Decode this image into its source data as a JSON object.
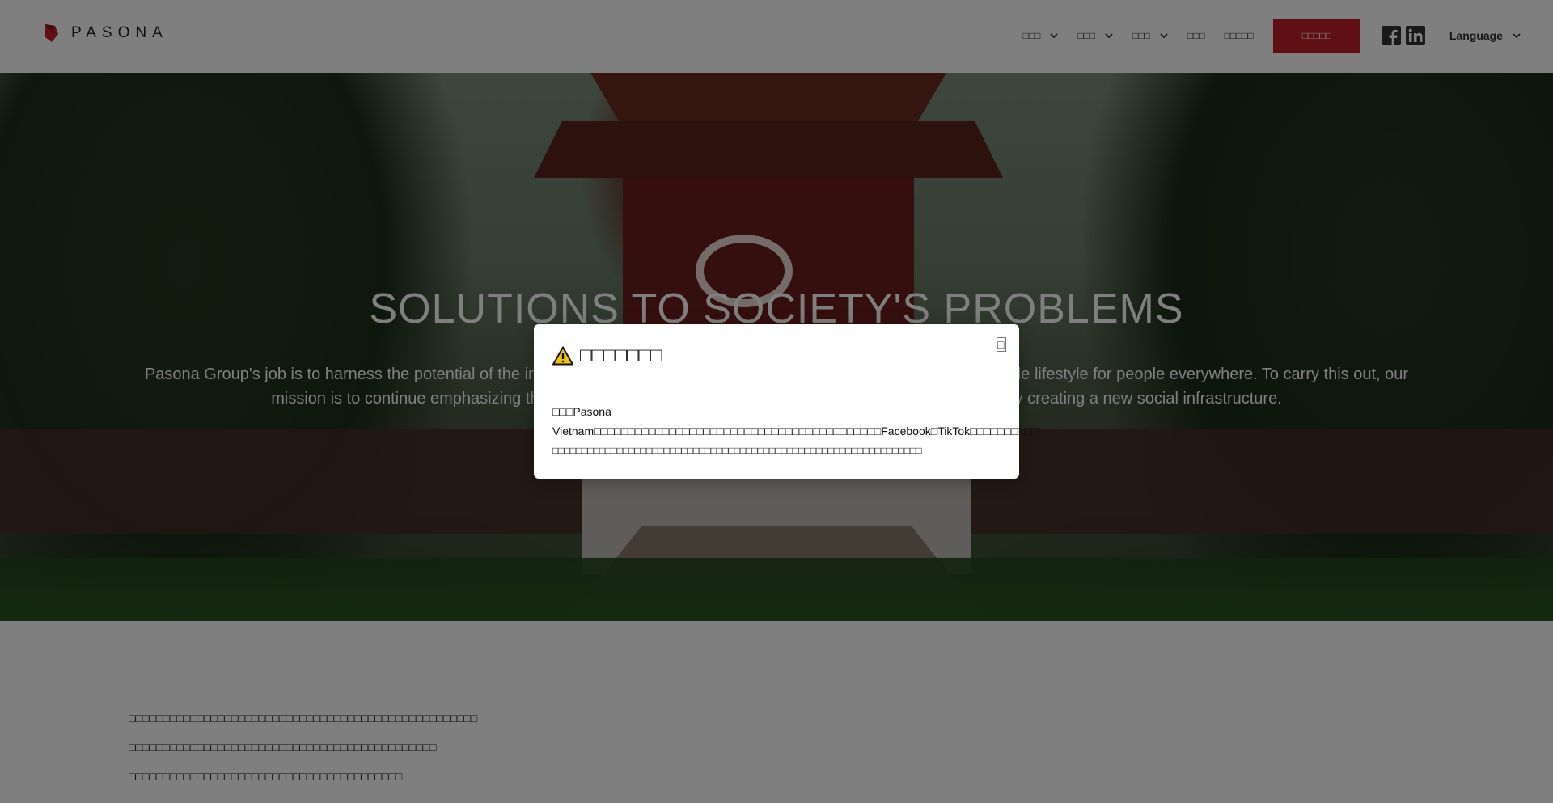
{
  "header": {
    "logo_text": "PASONA",
    "nav": [
      {
        "label": "□□□",
        "has_dropdown": true
      },
      {
        "label": "□□□",
        "has_dropdown": true
      },
      {
        "label": "□□□",
        "has_dropdown": true
      },
      {
        "label": "□□□",
        "has_dropdown": false
      },
      {
        "label": "□□□□□",
        "has_dropdown": false
      }
    ],
    "cta_label": "□□□□□",
    "social": [
      "facebook-icon",
      "linkedin-icon"
    ],
    "language_label": "Language",
    "brand_color": "#c0202a"
  },
  "hero": {
    "title": "SOLUTIONS TO SOCIETY'S PROBLEMS",
    "text": "Pasona Group's job is to harness the potential of the individual and provide the environment needed to create a comfortable lifestyle for people everywhere. To carry this out, our mission is to continue emphasizing the importance of individuals while aiming to solve social problems by creating a new social infrastructure."
  },
  "body": {
    "lines": [
      "□□□□□□□□□□□□□□□□□□□□□□□□□□□□□□□□□□□□□□□□□□□□□□□□□□□",
      "□□□□□□□□□□□□□□□□□□□□□□□□□□□□□□□□□□□□□□□□□□□□□",
      "□□□□□□□□□□□□□□□□□□□□□□□□□□□□□□□□□□□□□□□□"
    ]
  },
  "modal": {
    "title": "□□□□□□□",
    "close_glyph": "□",
    "line1": "□□□Pasona Vietnam□□□□□□□□□□□□□□□□□□□□□□□□□□□□□□□□□□□□□□□□□□Facebook□TikTok□□□□□□□□□□",
    "line2": "□□□□□□□□□□□□□□□□□□□□□□□□□□□□□□□□□□□□□□□□□□□□□□□□□□□□□□□□□□□□□□□"
  }
}
